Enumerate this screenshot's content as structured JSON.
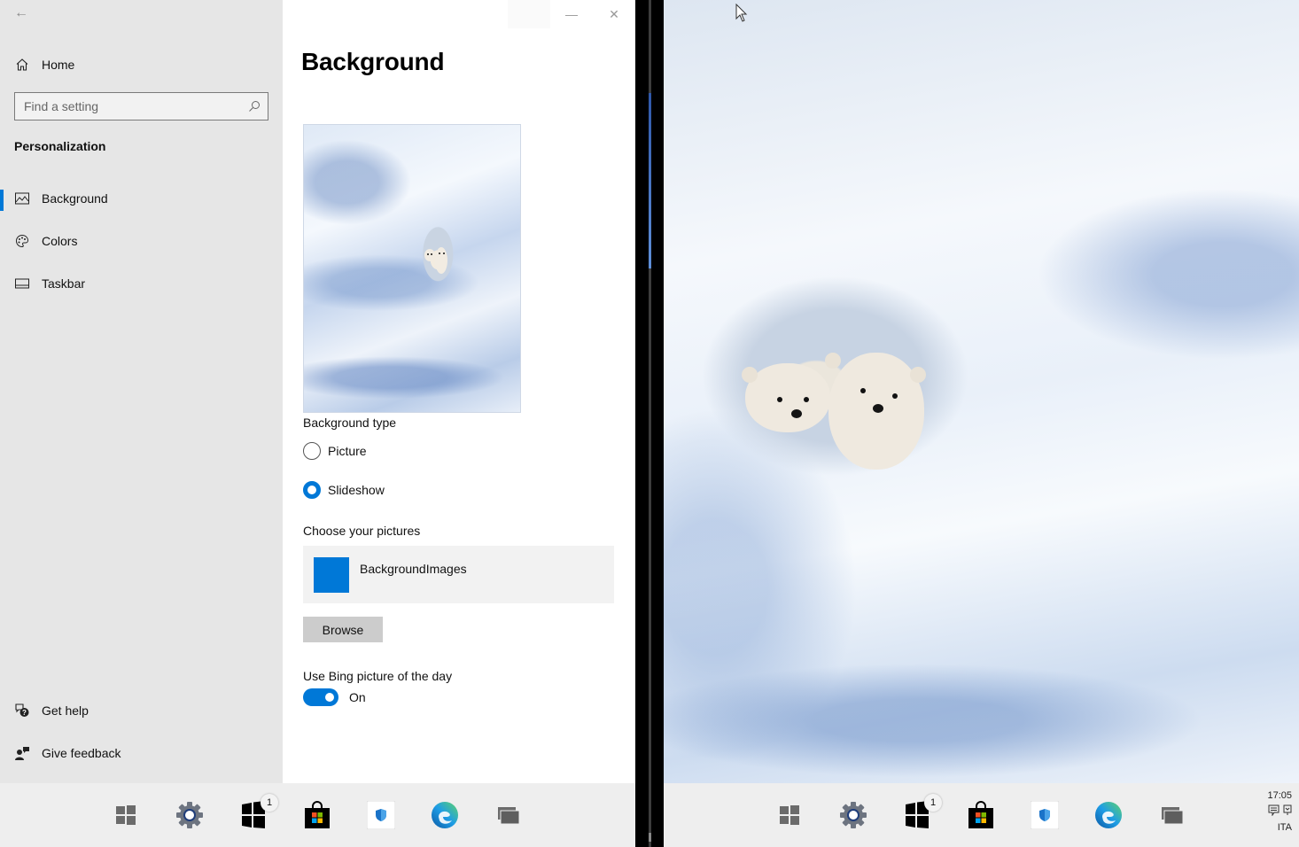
{
  "settings": {
    "nav": {
      "back_label": "Back",
      "home_label": "Home",
      "search_placeholder": "Find a setting",
      "section_title": "Personalization",
      "items": [
        {
          "label": "Background",
          "icon": "picture-icon",
          "selected": true
        },
        {
          "label": "Colors",
          "icon": "palette-icon",
          "selected": false
        },
        {
          "label": "Taskbar",
          "icon": "taskbar-icon",
          "selected": false
        }
      ],
      "footer": [
        {
          "label": "Get help",
          "icon": "help-chat-icon"
        },
        {
          "label": "Give feedback",
          "icon": "feedback-icon"
        }
      ]
    },
    "content": {
      "title": "Background",
      "background_type_label": "Background type",
      "radio_options": [
        {
          "label": "Picture",
          "checked": false
        },
        {
          "label": "Slideshow",
          "checked": true
        }
      ],
      "choose_pictures_label": "Choose your pictures",
      "album_name": "BackgroundImages",
      "browse_label": "Browse",
      "bing_label": "Use Bing picture of the day",
      "bing_toggle_state": "On",
      "bing_toggle_on": true
    },
    "window_controls": {
      "minimize": "—",
      "close": "✕"
    }
  },
  "colors": {
    "accent": "#0078d7",
    "nav_background": "#e6e6e6",
    "taskbar_background": "#eeeeee"
  },
  "taskbar": {
    "icons": [
      {
        "name": "start",
        "label": "Start"
      },
      {
        "name": "settings",
        "label": "Settings"
      },
      {
        "name": "windows-logo-app",
        "label": "Windows",
        "badge": "1"
      },
      {
        "name": "store",
        "label": "Microsoft Store"
      },
      {
        "name": "security",
        "label": "Windows Security"
      },
      {
        "name": "edge",
        "label": "Microsoft Edge"
      },
      {
        "name": "task-view",
        "label": "Task View"
      }
    ],
    "tray": {
      "time": "17:05",
      "language": "ITA"
    }
  }
}
